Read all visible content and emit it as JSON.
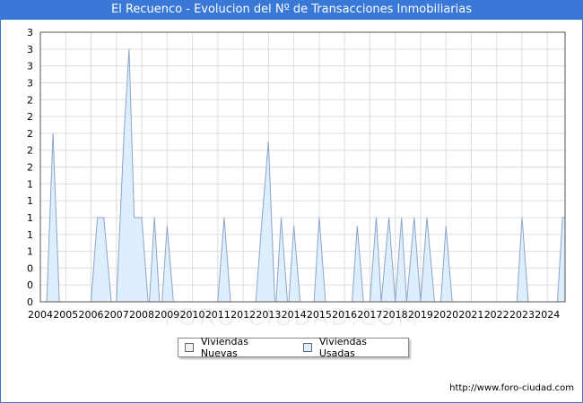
{
  "header": {
    "title": "El Recuenco - Evolucion del Nº de Transacciones Inmobiliarias"
  },
  "footer": {
    "url": "http://www.foro-ciudad.com"
  },
  "watermark": "FORO-CIUDAD.COM",
  "colors": {
    "title_bar": "#3a78d8",
    "series_nuevas_fill": "#f2f2f2",
    "series_usadas_fill": "#ddeeff",
    "series_usadas_line": "#8da4c8",
    "grid": "#dddddd"
  },
  "chart_data": {
    "type": "area",
    "title": "El Recuenco - Evolucion del Nº de Transacciones Inmobiliarias",
    "xlabel": "",
    "ylabel": "",
    "xlim": [
      2004,
      2024.7
    ],
    "ylim": [
      0,
      3.2
    ],
    "y_ticks": [
      0,
      0.2,
      0.4,
      0.6,
      0.8,
      1.0,
      1.2,
      1.4,
      1.6,
      1.8,
      2.0,
      2.2,
      2.4,
      2.6,
      2.8,
      3.0,
      3.2
    ],
    "y_tick_labels": [
      "0",
      "0",
      "0",
      "1",
      "1",
      "1",
      "1",
      "1",
      "2",
      "2",
      "2",
      "2",
      "2",
      "3",
      "3",
      "3",
      "3"
    ],
    "x_tick_labels": [
      "2004",
      "2005",
      "2006",
      "2007",
      "2008",
      "2009",
      "2010",
      "2011",
      "2012",
      "2013",
      "2014",
      "2015",
      "2016",
      "2017",
      "2018",
      "2019",
      "2020",
      "2021",
      "2022",
      "2023",
      "2024"
    ],
    "grid": true,
    "legend_position": "bottom-center",
    "legend": [
      "Viviendas Nuevas",
      "Viviendas Usadas"
    ],
    "series": [
      {
        "name": "Viviendas Nuevas",
        "points": []
      },
      {
        "name": "Viviendas Usadas",
        "points": [
          [
            2004.25,
            0
          ],
          [
            2004.5,
            2
          ],
          [
            2004.75,
            0
          ],
          [
            2006.0,
            0
          ],
          [
            2006.25,
            1
          ],
          [
            2006.5,
            1
          ],
          [
            2006.8,
            0
          ],
          [
            2007.0,
            0
          ],
          [
            2007.3,
            2
          ],
          [
            2007.5,
            3
          ],
          [
            2007.7,
            1
          ],
          [
            2008.0,
            1
          ],
          [
            2008.25,
            0
          ],
          [
            2008.3,
            0
          ],
          [
            2008.5,
            1
          ],
          [
            2008.7,
            0
          ],
          [
            2008.8,
            0
          ],
          [
            2009.0,
            0.9
          ],
          [
            2009.25,
            0
          ],
          [
            2011.0,
            0
          ],
          [
            2011.25,
            1
          ],
          [
            2011.5,
            0
          ],
          [
            2012.5,
            0
          ],
          [
            2012.75,
            1
          ],
          [
            2013.0,
            1.9
          ],
          [
            2013.25,
            0
          ],
          [
            2013.3,
            0
          ],
          [
            2013.5,
            1
          ],
          [
            2013.75,
            0
          ],
          [
            2013.8,
            0
          ],
          [
            2014.0,
            0.9
          ],
          [
            2014.25,
            0
          ],
          [
            2014.8,
            0
          ],
          [
            2015.0,
            1
          ],
          [
            2015.25,
            0
          ],
          [
            2016.3,
            0
          ],
          [
            2016.5,
            0.9
          ],
          [
            2016.75,
            0
          ],
          [
            2017.0,
            0
          ],
          [
            2017.25,
            1
          ],
          [
            2017.45,
            0
          ],
          [
            2017.75,
            1
          ],
          [
            2018.0,
            0
          ],
          [
            2018.25,
            1
          ],
          [
            2018.45,
            0
          ],
          [
            2018.75,
            1
          ],
          [
            2019.0,
            0
          ],
          [
            2019.25,
            1
          ],
          [
            2019.55,
            0
          ],
          [
            2019.8,
            0
          ],
          [
            2020.0,
            0.9
          ],
          [
            2020.25,
            0
          ],
          [
            2022.8,
            0
          ],
          [
            2023.0,
            1
          ],
          [
            2023.25,
            0
          ],
          [
            2024.4,
            0
          ],
          [
            2024.6,
            1
          ],
          [
            2024.7,
            1
          ]
        ]
      }
    ]
  }
}
